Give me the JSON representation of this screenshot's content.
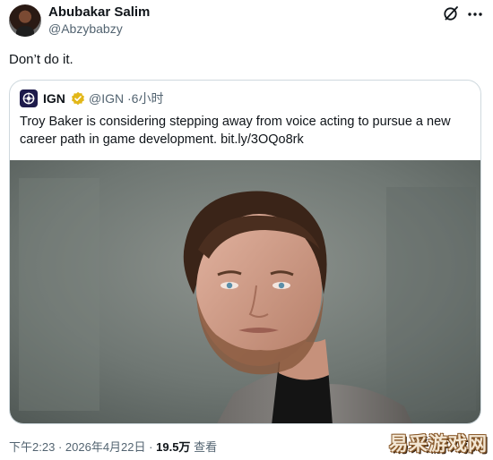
{
  "tweet": {
    "author_name": "Abubakar Salim",
    "author_handle": "@Abzybabzy",
    "text": "Don’t do it.",
    "time": "下午2:23",
    "date": "2026年4月22日",
    "views_count": "19.5万",
    "views_label": "查看",
    "separator": "·"
  },
  "quote": {
    "author_name": "IGN",
    "author_handle": "@IGN",
    "time_ago": "6小时",
    "separator": "·",
    "text": "Troy Baker is considering stepping away from voice acting to pursue a new career path in game development. bit.ly/3OQo8rk"
  },
  "watermark": "易采游戏网",
  "icons": {
    "grok": "grok-icon",
    "more": "more-options-icon",
    "verified": "verified-badge-icon",
    "logo": "ign-logo-icon"
  },
  "colors": {
    "text": "#0f1419",
    "secondary": "#536471",
    "border": "#cfd9de",
    "verified_gold": "#e2b719"
  }
}
